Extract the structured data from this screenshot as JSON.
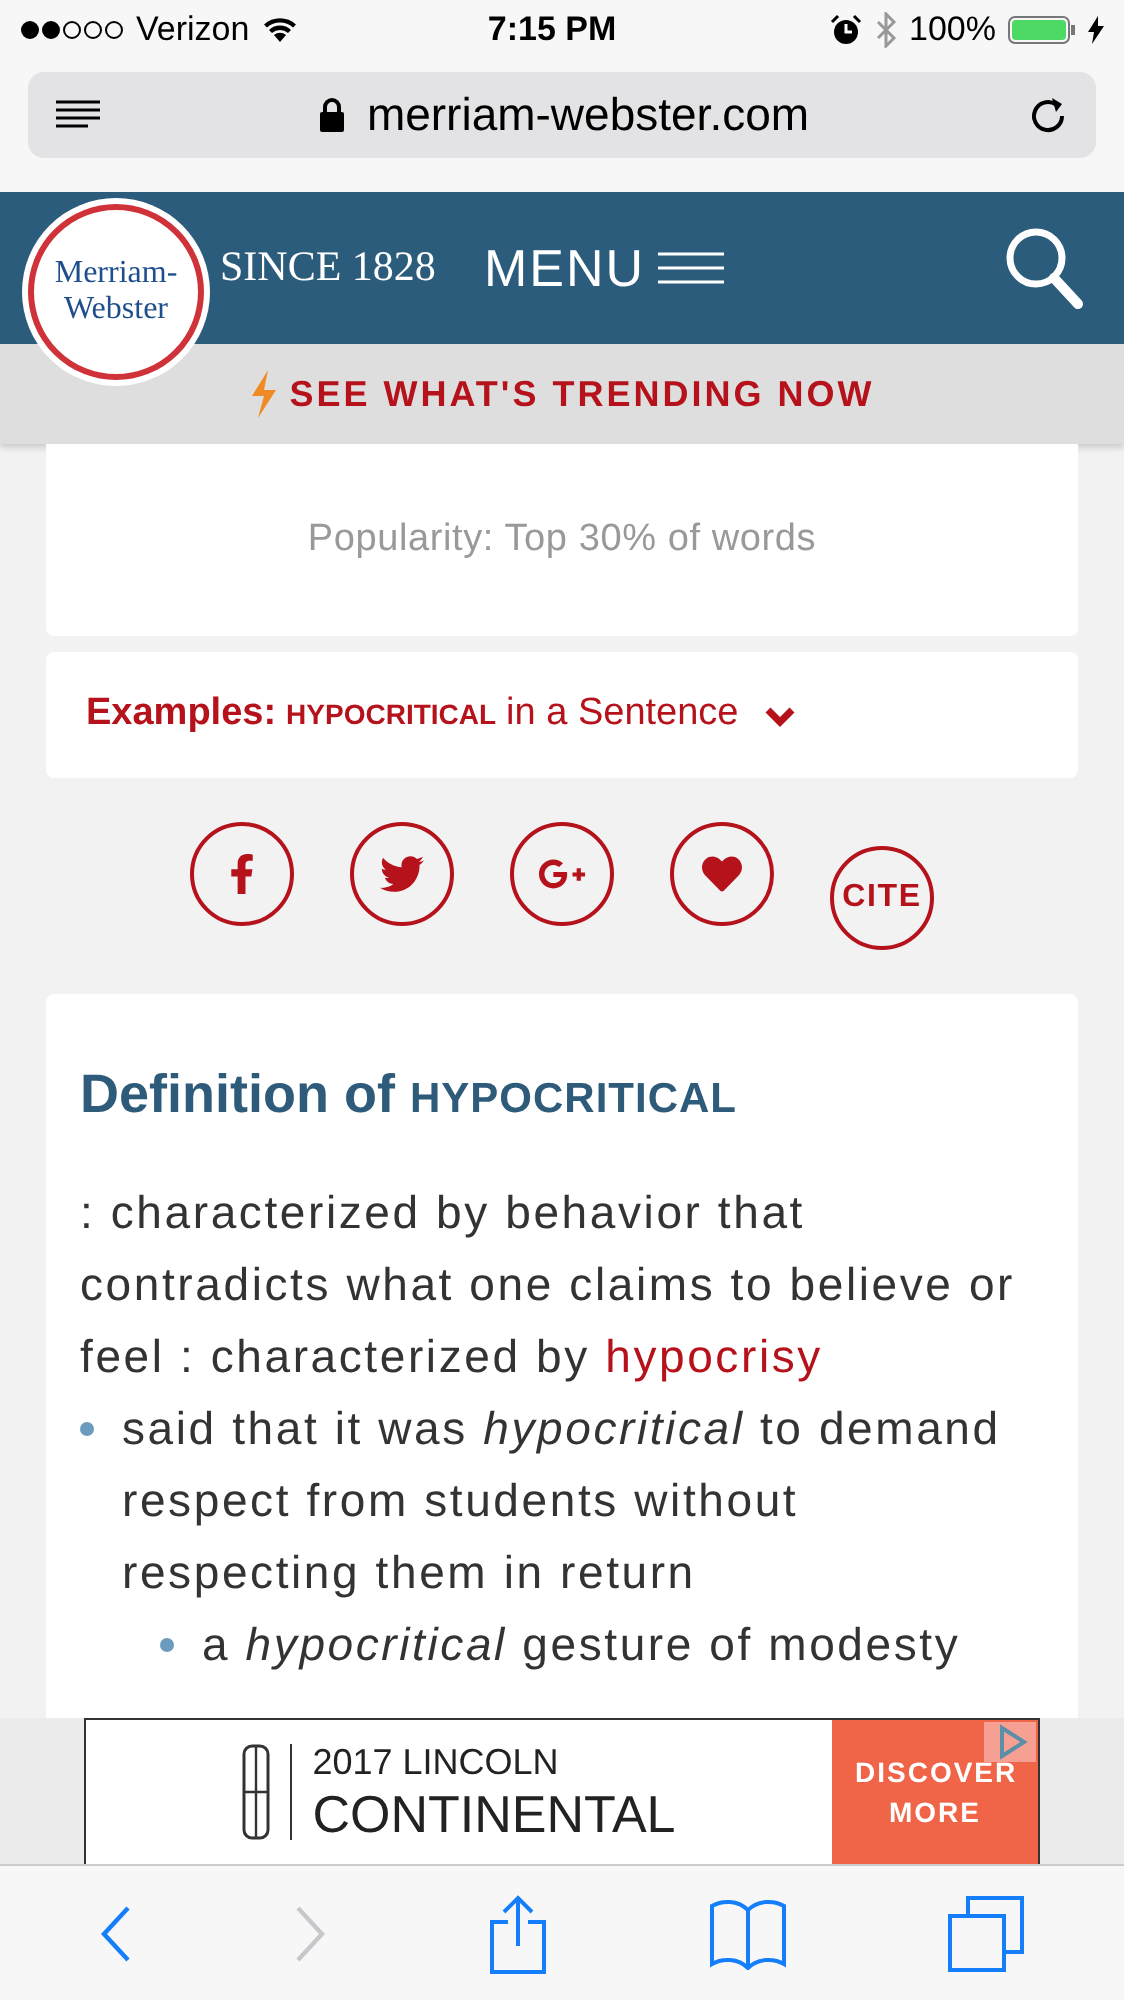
{
  "status_bar": {
    "carrier": "Verizon",
    "time": "7:15 PM",
    "battery": "100%"
  },
  "url_bar": {
    "url": "merriam-webster.com"
  },
  "header": {
    "logo_lines": [
      "Merriam-",
      "Webster"
    ],
    "tagline": "SINCE 1828",
    "menu": "MENU"
  },
  "trending": {
    "label": "SEE WHAT'S TRENDING NOW"
  },
  "popularity": {
    "text": "Popularity: Top 30% of words"
  },
  "examples": {
    "label": "Examples:",
    "word": "HYPOCRITICAL",
    "rest": "in a Sentence",
    "expanded": false
  },
  "share": [
    {
      "kind": "facebook"
    },
    {
      "kind": "twitter"
    },
    {
      "kind": "googleplus"
    },
    {
      "kind": "favorite"
    },
    {
      "kind": "cite",
      "label": "CITE"
    }
  ],
  "definition": {
    "title": "Definition of",
    "word": "HYPOCRITICAL",
    "sense": ":  characterized by behavior that contradicts what one claims to believe or feel :  characterized by",
    "link": "hypocrisy",
    "examples": [
      {
        "text": "said that it was *hypocritical* to demand respect from students without respecting them in return",
        "children": [
          {
            "text": "a *hypocritical* gesture of modesty"
          }
        ]
      }
    ]
  },
  "ad": {
    "line_1": "2017 LINCOLN",
    "line_2": "CONTINENTAL",
    "cta": "DISCOVER MORE"
  }
}
